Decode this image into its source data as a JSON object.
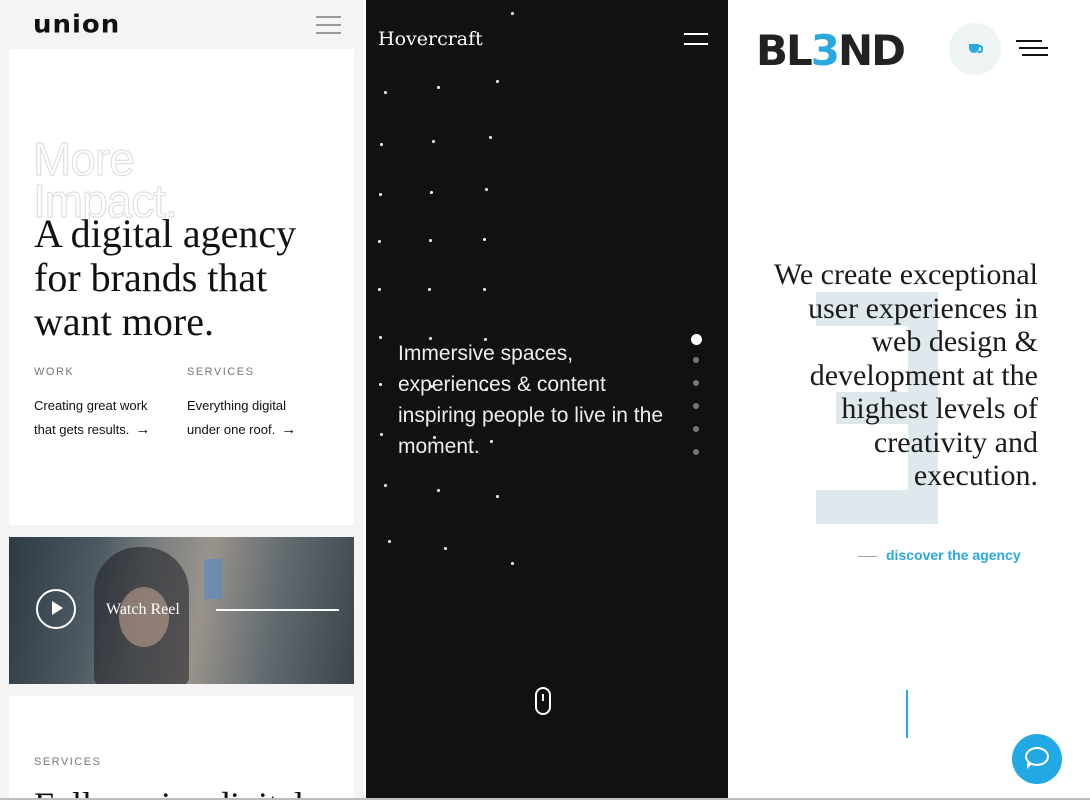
{
  "union": {
    "logo": "union",
    "outline_text_1": "More",
    "outline_text_2": "Impact.",
    "headline": "A digital agency for brands that want more.",
    "work_label": "WORK",
    "work_text_1": "Creating great work",
    "work_text_2": "that gets results.",
    "services_label": "SERVICES",
    "services_text_1": "Everything digital",
    "services_text_2": "under one roof.",
    "arrow": "→",
    "video_label": "Watch Reel",
    "section_label": "SERVICES",
    "section_heading": "Full service digital"
  },
  "hovercraft": {
    "logo": "Hovercraft",
    "tagline": "Immersive spaces, experiences & content inspiring people to live in the moment.",
    "slide_count": 6,
    "active_slide": 1
  },
  "blend": {
    "logo_part1": "BL",
    "logo_accent": "3",
    "logo_part2": "ND",
    "headline": "We create exceptional user experiences in web design & development at the highest levels of creativity and execution.",
    "discover_link": "discover the agency",
    "accent_color": "#2aa8e0"
  }
}
